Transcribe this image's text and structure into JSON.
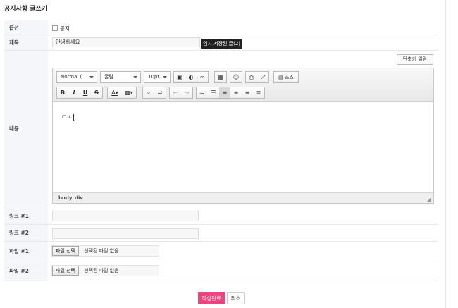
{
  "page": {
    "title": "공지사항 글쓰기"
  },
  "form": {
    "option": {
      "label": "옵션",
      "checkbox_label": "공지",
      "checked": false
    },
    "subject": {
      "label": "제목",
      "value": "안녕하세요",
      "tooltip": "임시 저장된 글(2)"
    },
    "content": {
      "label": "내용",
      "shortcut_button": "단축키 일람",
      "body_text": "ㄷㅗ",
      "toolbar": {
        "format_combo": "Normal (...",
        "font_combo": "굴림",
        "size_combo": "10pt",
        "source_label": "소스",
        "row1_icons": [
          "image-icon",
          "flash-icon",
          "link-icon",
          "table-icon",
          "emoticon-icon",
          "print-icon",
          "fullscreen-icon",
          "source-icon"
        ],
        "row2_icons": [
          "bold-icon",
          "italic-icon",
          "underline-icon",
          "strike-icon",
          "text-color-icon",
          "bg-color-icon",
          "find-icon",
          "replace-icon",
          "outdent-icon",
          "indent-icon",
          "ordered-list-icon",
          "unordered-list-icon",
          "align-left-icon",
          "align-center-icon",
          "align-right-icon",
          "justify-icon"
        ]
      },
      "path": [
        "body",
        "div"
      ]
    },
    "link1": {
      "label": "링크 #1",
      "value": ""
    },
    "link2": {
      "label": "링크 #2",
      "value": ""
    },
    "file1": {
      "label": "파일 #1",
      "button": "파일 선택",
      "status": "선택된 파일 없음"
    },
    "file2": {
      "label": "파일 #2",
      "button": "파일 선택",
      "status": "선택된 파일 없음"
    }
  },
  "actions": {
    "submit": "작성완료",
    "cancel": "취소"
  },
  "colors": {
    "submit_bg": "#f0437c",
    "label_bg": "#f4f6fa"
  }
}
